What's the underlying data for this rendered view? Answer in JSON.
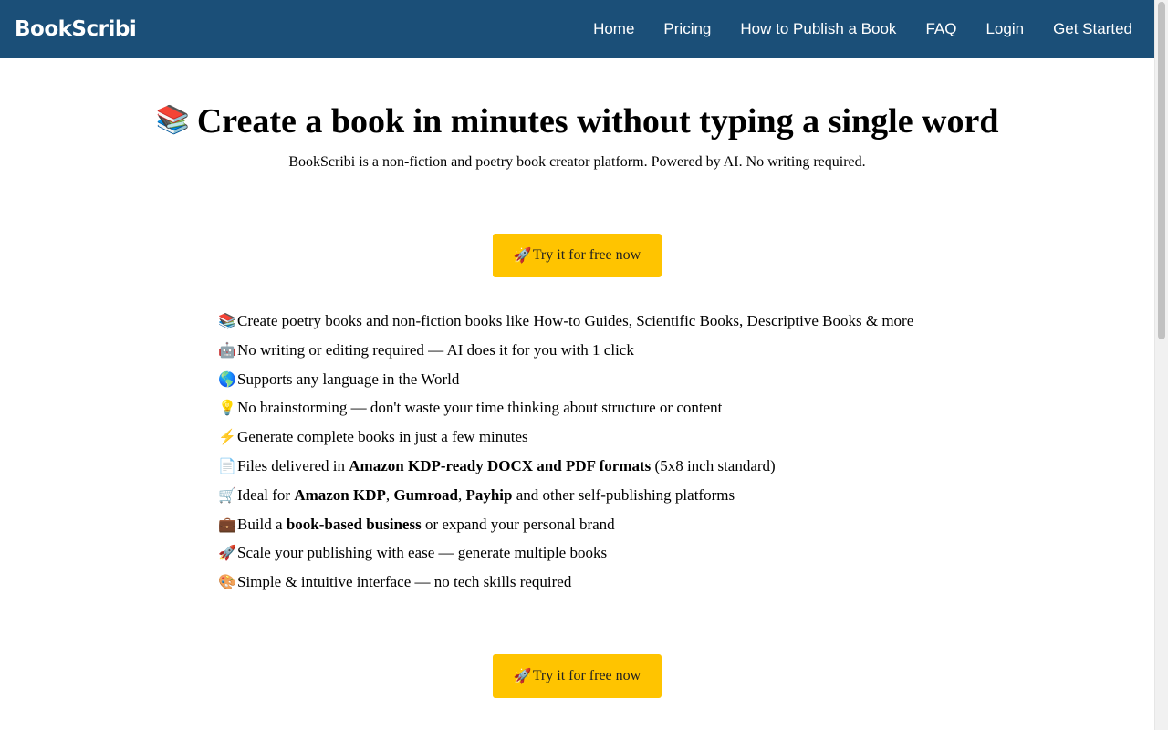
{
  "nav": {
    "brand": "BookScribi",
    "links": [
      "Home",
      "Pricing",
      "How to Publish a Book",
      "FAQ",
      "Login",
      "Get Started"
    ]
  },
  "hero": {
    "emoji": "📚",
    "title": "Create a book in minutes without typing a single word",
    "subtitle": "BookScribi is a non-fiction and poetry book creator platform. Powered by AI. No writing required."
  },
  "cta": {
    "icon": "🚀",
    "label": "Try it for free now"
  },
  "features": [
    {
      "icon": "📚",
      "parts": [
        {
          "t": "Create poetry books and non-fiction books like How-to Guides, Scientific Books, Descriptive Books & more",
          "b": false
        }
      ]
    },
    {
      "icon": "🤖",
      "parts": [
        {
          "t": "No writing or editing required — AI does it for you with 1 click",
          "b": false
        }
      ]
    },
    {
      "icon": "🌎",
      "parts": [
        {
          "t": "Supports any language in the World",
          "b": false
        }
      ]
    },
    {
      "icon": "💡",
      "parts": [
        {
          "t": "No brainstorming — don't waste your time thinking about structure or content",
          "b": false
        }
      ]
    },
    {
      "icon": "⚡",
      "parts": [
        {
          "t": "Generate complete books in just a few minutes",
          "b": false
        }
      ]
    },
    {
      "icon": "📄",
      "parts": [
        {
          "t": "Files delivered in ",
          "b": false
        },
        {
          "t": "Amazon KDP-ready DOCX and PDF formats",
          "b": true
        },
        {
          "t": " (5x8 inch standard)",
          "b": false
        }
      ]
    },
    {
      "icon": "🛒",
      "parts": [
        {
          "t": "Ideal for ",
          "b": false
        },
        {
          "t": "Amazon KDP",
          "b": true
        },
        {
          "t": ", ",
          "b": false
        },
        {
          "t": "Gumroad",
          "b": true
        },
        {
          "t": ", ",
          "b": false
        },
        {
          "t": "Payhip",
          "b": true
        },
        {
          "t": " and other self-publishing platforms",
          "b": false
        }
      ]
    },
    {
      "icon": "💼",
      "parts": [
        {
          "t": "Build a ",
          "b": false
        },
        {
          "t": "book-based business",
          "b": true
        },
        {
          "t": " or expand your personal brand",
          "b": false
        }
      ]
    },
    {
      "icon": "🚀",
      "parts": [
        {
          "t": "Scale your publishing with ease — generate multiple books",
          "b": false
        }
      ]
    },
    {
      "icon": "🎨",
      "parts": [
        {
          "t": "Simple & intuitive interface — no tech skills required",
          "b": false
        }
      ]
    }
  ],
  "colors": {
    "navbar": "#1b4f78",
    "cta": "#ffc400"
  }
}
